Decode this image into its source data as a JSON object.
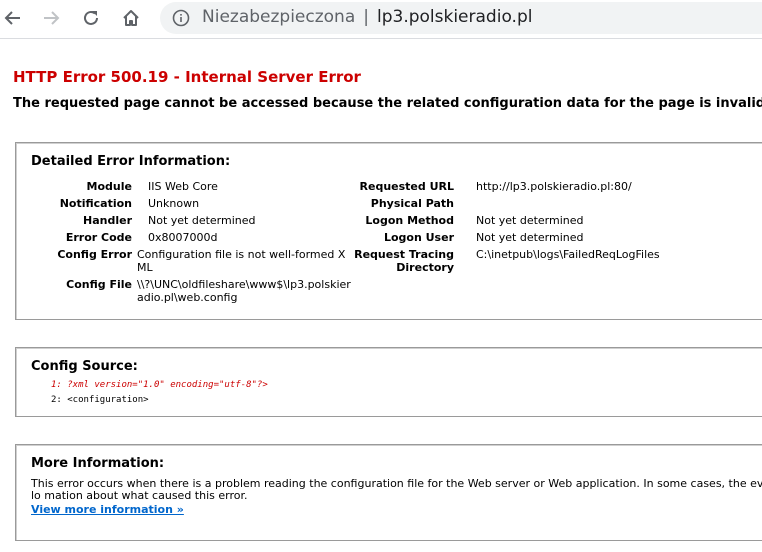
{
  "browser": {
    "security_label": "Niezabezpieczona",
    "host": "lp3.polskieradio.pl"
  },
  "error": {
    "title": "HTTP Error 500.19 - Internal Server Error",
    "subtitle": "The requested page cannot be accessed because the related configuration data for the page is invalid."
  },
  "detail": {
    "heading": "Detailed Error Information:",
    "left": [
      {
        "label": "Module",
        "value": "IIS Web Core"
      },
      {
        "label": "Notification",
        "value": "Unknown"
      },
      {
        "label": "Handler",
        "value": "Not yet determined"
      },
      {
        "label": "Error Code",
        "value": "0x8007000d"
      },
      {
        "label": "Config Error",
        "value": "Configuration file is not well-formed XML"
      },
      {
        "label": "Config File",
        "value": "\\\\?\\UNC\\oldfileshare\\www$\\lp3.polskieradio.pl\\web.config"
      }
    ],
    "right": [
      {
        "label": "Requested URL",
        "value": "http://lp3.polskieradio.pl:80/"
      },
      {
        "label": "Physical Path",
        "value": ""
      },
      {
        "label": "Logon Method",
        "value": "Not yet determined"
      },
      {
        "label": "Logon User",
        "value": "Not yet determined"
      },
      {
        "label": "Request Tracing Directory",
        "value": "C:\\inetpub\\logs\\FailedReqLogFiles"
      }
    ]
  },
  "source": {
    "heading": "Config Source:",
    "lines": [
      {
        "num": "1:",
        "text": "?xml version=\"1.0\" encoding=\"utf-8\"?>"
      },
      {
        "num": "2:",
        "text": "<configuration>"
      }
    ]
  },
  "more": {
    "heading": "More Information:",
    "text": "This error occurs when there is a problem reading the configuration file for the Web server or Web application. In some cases, the event lo mation about what caused this error.",
    "link": "View more information »"
  }
}
